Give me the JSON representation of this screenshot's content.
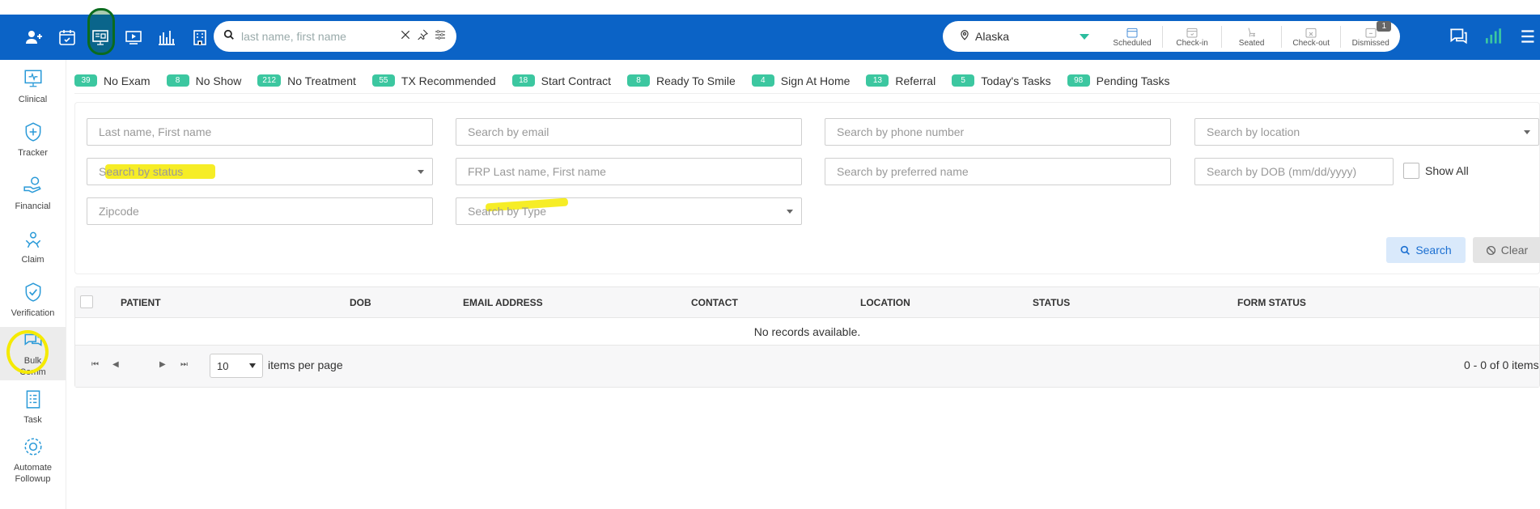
{
  "topbar": {
    "icons": [
      "add-user-icon",
      "calendar-check-icon",
      "dashboard-monitor-icon",
      "video-icon",
      "bar-chart-icon",
      "building-icon"
    ],
    "search_placeholder": "last name, first name",
    "location": "Alaska",
    "statuses": [
      {
        "label": "Scheduled",
        "icon": "calendar-icon"
      },
      {
        "label": "Check-in",
        "icon": "calendar-checkin-icon"
      },
      {
        "label": "Seated",
        "icon": "dental-chair-icon"
      },
      {
        "label": "Check-out",
        "icon": "calendar-x-icon"
      },
      {
        "label": "Dismissed",
        "icon": "calendar-dismiss-icon",
        "badge": "1"
      }
    ]
  },
  "sidebar": {
    "items": [
      {
        "label": "Clinical",
        "icon": "clinical-monitor-icon"
      },
      {
        "label": "Tracker",
        "icon": "tracker-shield-icon"
      },
      {
        "label": "Financial",
        "icon": "financial-hand-icon"
      },
      {
        "label": "Claim",
        "icon": "claim-icon"
      },
      {
        "label": "Verification",
        "icon": "verification-shield-icon"
      },
      {
        "label": "Bulk\nComm",
        "label1": "Bulk",
        "label2": "Comm",
        "icon": "chat-bubbles-icon"
      },
      {
        "label": "Task",
        "icon": "task-list-icon"
      },
      {
        "label1": "Automate",
        "label2": "Followup",
        "icon": "gear-icon"
      }
    ]
  },
  "tags": [
    {
      "count": "39",
      "label": "No Exam"
    },
    {
      "count": "8",
      "label": "No Show"
    },
    {
      "count": "212",
      "label": "No Treatment"
    },
    {
      "count": "55",
      "label": "TX Recommended"
    },
    {
      "count": "18",
      "label": "Start Contract"
    },
    {
      "count": "8",
      "label": "Ready To Smile"
    },
    {
      "count": "4",
      "label": "Sign At Home"
    },
    {
      "count": "13",
      "label": "Referral"
    },
    {
      "count": "5",
      "label": "Today's Tasks"
    },
    {
      "count": "98",
      "label": "Pending Tasks"
    }
  ],
  "form": {
    "name_placeholder": "Last name, First name",
    "email_placeholder": "Search by email",
    "phone_placeholder": "Search by phone number",
    "location_placeholder": "Search by location",
    "status_placeholder": "Search by status",
    "frp_placeholder": "FRP Last name, First name",
    "preferred_placeholder": "Search by preferred name",
    "dob_placeholder": "Search by DOB (mm/dd/yyyy)",
    "show_all": "Show All",
    "zip_placeholder": "Zipcode",
    "type_placeholder": "Search by Type",
    "search_btn": "Search",
    "clear_btn": "Clear"
  },
  "grid": {
    "columns": [
      "PATIENT",
      "DOB",
      "EMAIL ADDRESS",
      "CONTACT",
      "LOCATION",
      "STATUS",
      "FORM STATUS"
    ],
    "empty": "No records available.",
    "page_size": "10",
    "items_per_page": "items per page",
    "summary": "0 - 0 of 0 items"
  },
  "colors": {
    "topbar": "#0b63c6",
    "accent": "#3cc7a0",
    "highlight": "#f5ea00"
  }
}
